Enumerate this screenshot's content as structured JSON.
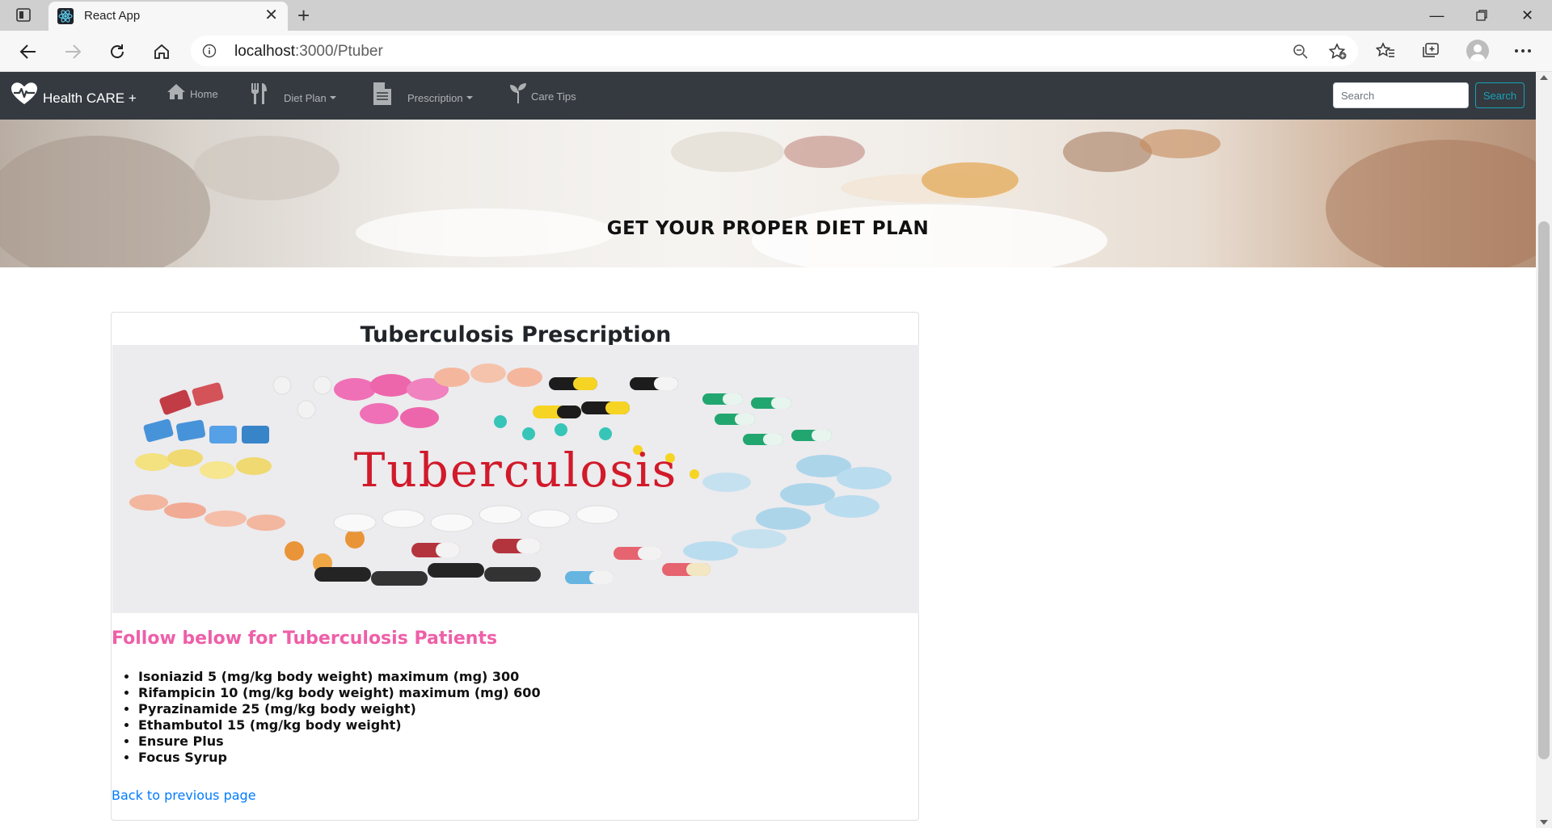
{
  "browser": {
    "tab_title": "React App",
    "url_host": "localhost",
    "url_path": ":3000/Ptuber"
  },
  "navbar": {
    "brand": "Health CARE +",
    "items": [
      {
        "label": "Home",
        "icon": "home-icon"
      },
      {
        "label": "Diet Plan",
        "icon": "utensils-icon",
        "dropdown": true
      },
      {
        "label": "Prescription",
        "icon": "document-icon",
        "dropdown": true
      },
      {
        "label": "Care Tips",
        "icon": "seedling-icon"
      }
    ],
    "search_placeholder": "Search",
    "search_button": "Search"
  },
  "hero": {
    "title": "GET YOUR PROPER DIET PLAN"
  },
  "card": {
    "title": "Tuberculosis Prescription",
    "image_word": "Tuberculosis",
    "heading": "Follow below for Tuberculosis Patients",
    "medications": [
      "Isoniazid 5 (mg/kg body weight) maximum (mg) 300",
      "Rifampicin 10 (mg/kg body weight) maximum (mg) 600",
      "Pyrazinamide 25 (mg/kg body weight)",
      "Ethambutol 15 (mg/kg body weight)",
      "Ensure Plus",
      "Focus Syrup"
    ],
    "back_link": "Back to previous page"
  },
  "colors": {
    "navbar_bg": "#343a40",
    "accent_pink": "#ee5fa8",
    "link_blue": "#007bff",
    "search_btn": "#17a2b8"
  }
}
